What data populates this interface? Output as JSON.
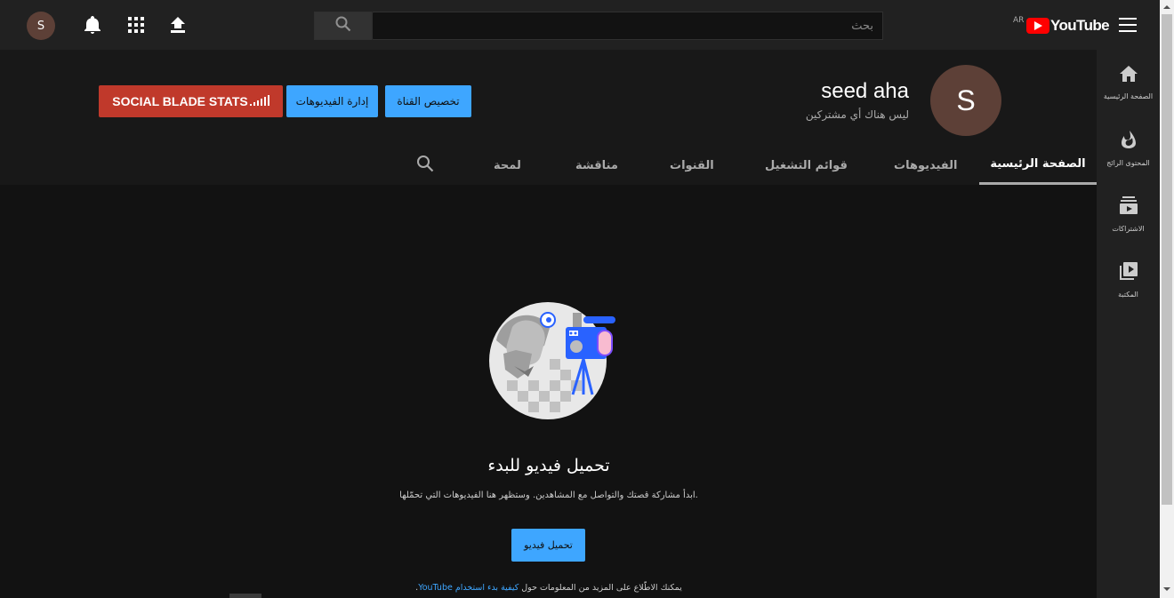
{
  "masthead": {
    "avatar_letter": "S",
    "search_placeholder": "بحث",
    "logo_text": "YouTube",
    "logo_country": "AR",
    "icons": [
      "account-avatar",
      "notifications-icon",
      "apps-icon",
      "upload-icon",
      "search-icon",
      "menu-icon"
    ]
  },
  "channel": {
    "avatar_letter": "S",
    "name": "seed aha",
    "subscribers": "ليس هناك أي مشتركين",
    "buttons": {
      "customize": "تخصيص القناة",
      "manage_videos": "إدارة الفيديوهات",
      "social_blade": "SOCIAL BLADE STATS"
    }
  },
  "tabs": {
    "home": "الصفحة الرئيسية",
    "videos": "الفيديوهات",
    "playlists": "قوائم التشغيل",
    "channels": "القنوات",
    "discussion": "مناقشة",
    "about": "لمحة"
  },
  "guide": {
    "items": [
      {
        "label": "الصفحة الرئيسية",
        "icon": "home-icon"
      },
      {
        "label": "المحتوى الرائج",
        "icon": "trending-icon"
      },
      {
        "label": "الاشتراكات",
        "icon": "subscriptions-icon"
      },
      {
        "label": "المكتبة",
        "icon": "library-icon"
      }
    ]
  },
  "empty_state": {
    "title": "تحميل فيديو للبدء",
    "description": "ابدأ مشاركة قصتك والتواصل مع المشاهدين. وستظهر هنا الفيديوهات التي تحمّلها.",
    "upload_button": "تحميل فيديو",
    "learn_more_prefix": "يمكنك الاطّلاع على المزيد من المعلومات حول ",
    "learn_more_link": "كيفية بدء استخدام YouTube",
    "learn_more_suffix": "."
  },
  "colors": {
    "background": "#121212",
    "masthead": "#212121",
    "accent_blue": "#3ea6ff",
    "social_blade_red": "#c0392b",
    "youtube_red": "#ff0000"
  }
}
